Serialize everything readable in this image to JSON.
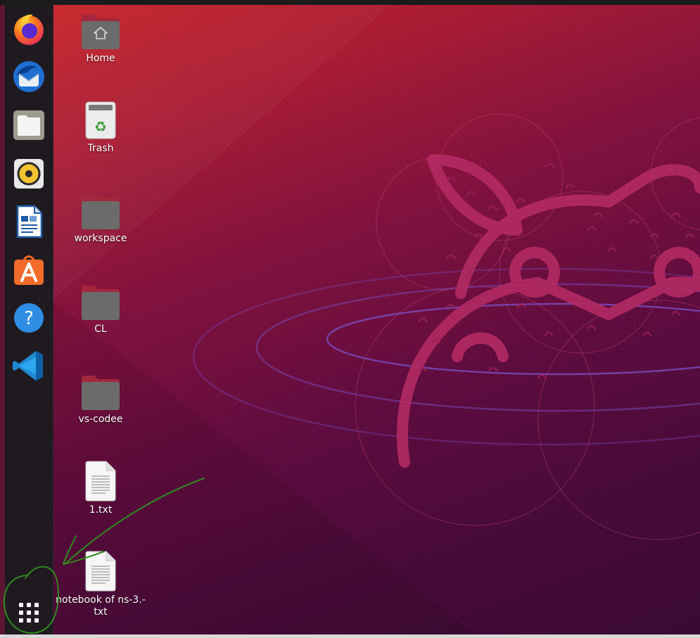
{
  "dock": {
    "apps": [
      {
        "name": "Firefox",
        "icon": "firefox-icon"
      },
      {
        "name": "Thunderbird Mail",
        "icon": "thunderbird-icon"
      },
      {
        "name": "Files",
        "icon": "files-icon"
      },
      {
        "name": "Rhythmbox",
        "icon": "rhythmbox-icon"
      },
      {
        "name": "LibreOffice Writer",
        "icon": "writer-icon"
      },
      {
        "name": "Ubuntu Software",
        "icon": "software-icon"
      },
      {
        "name": "Help",
        "icon": "help-icon"
      },
      {
        "name": "Visual Studio Code",
        "icon": "vscode-icon"
      }
    ],
    "show_apps": {
      "icon": "app-grid-icon"
    }
  },
  "desktop": {
    "items": [
      {
        "label": "Home",
        "icon": "home-folder-icon"
      },
      {
        "label": "Trash",
        "icon": "trash-icon"
      },
      {
        "label": "workspace",
        "icon": "folder-icon"
      },
      {
        "label": "CL",
        "icon": "folder-icon"
      },
      {
        "label": "vs-codee",
        "icon": "folder-icon"
      },
      {
        "label": "1.txt",
        "icon": "text-file-icon"
      },
      {
        "label": "notebook of ns-3.-\ntxt",
        "icon": "text-file-icon"
      }
    ]
  },
  "colors": {
    "annotation": "#2e8b1e",
    "folder_body": "#6a6a6a",
    "folder_tab": "#a3283d",
    "dock_bg": "#1f1a20"
  }
}
